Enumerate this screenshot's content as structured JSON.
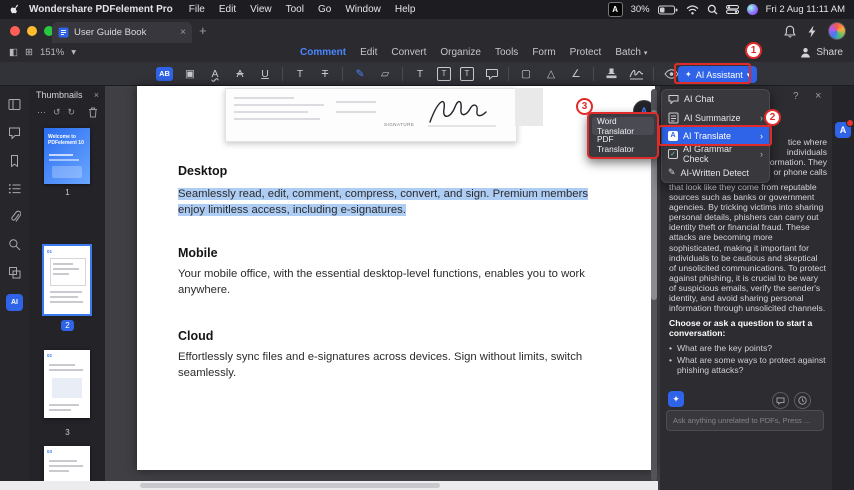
{
  "menubar": {
    "app_name": "Wondershare PDFelement Pro",
    "menus": [
      "File",
      "Edit",
      "View",
      "Tool",
      "Go",
      "Window",
      "Help"
    ],
    "capture_badge": "A",
    "battery": "30%",
    "clock": "Fri 2 Aug 11:11 AM"
  },
  "titlebar": {
    "tab_title": "User Guide Book"
  },
  "ribbon": {
    "zoom": "151%",
    "tabs": [
      "Comment",
      "Edit",
      "Convert",
      "Organize",
      "Tools",
      "Form",
      "Protect",
      "Batch"
    ],
    "share": "Share",
    "ai_assistant": "AI Assistant"
  },
  "tools": {
    "icons": [
      {
        "name": "highlight",
        "glyph": "AB"
      },
      {
        "name": "area-highlight",
        "glyph": "▣"
      },
      {
        "name": "squiggly-underline",
        "glyph": "A"
      },
      {
        "name": "strikethrough",
        "glyph": "A"
      },
      {
        "name": "underline",
        "glyph": "U"
      },
      {
        "name": "insert-text",
        "glyph": "T"
      },
      {
        "name": "replace-text",
        "glyph": "T"
      },
      {
        "name": "pencil",
        "glyph": "✎"
      },
      {
        "name": "eraser",
        "glyph": "▱"
      },
      {
        "name": "text-comment",
        "glyph": "T"
      },
      {
        "name": "text-box",
        "glyph": "T"
      },
      {
        "name": "callout",
        "glyph": "T"
      },
      {
        "name": "shape-rect",
        "glyph": "▢"
      },
      {
        "name": "shape-polygon",
        "glyph": "△"
      },
      {
        "name": "measure",
        "glyph": "∠"
      }
    ]
  },
  "sidebar": {
    "panel_title": "Thumbnails",
    "thumbs": [
      {
        "label": "1",
        "title": "Welcome to PDFelement 10"
      },
      {
        "label": "2",
        "tag": "01"
      },
      {
        "label": "3",
        "tag": "02"
      },
      {
        "tag": "03"
      }
    ]
  },
  "document": {
    "signature_label": "SIGNATURE",
    "sections": [
      {
        "heading": "Desktop",
        "body": "Seamlessly read, edit, comment, compress, convert, and sign. Premium members enjoy limitless access, including e-signatures."
      },
      {
        "heading": "Mobile",
        "body": "Your mobile office, with the essential desktop-level functions, enables you to work anywhere."
      },
      {
        "heading": "Cloud",
        "body": "Effortlessly sync files and e-signatures across devices. Sign without limits, switch seamlessly."
      }
    ]
  },
  "translator_menu": {
    "items": [
      "Word Translator",
      "PDF Translator"
    ]
  },
  "ai_menu": {
    "items": [
      {
        "label": "AI Chat",
        "chevron": ""
      },
      {
        "label": "AI Summarize",
        "chevron": "›"
      },
      {
        "label": "AI Translate",
        "chevron": "›"
      },
      {
        "label": "AI Grammar Check",
        "chevron": "›"
      },
      {
        "label": "AI-Written Detect",
        "chevron": ""
      }
    ]
  },
  "ai_panel": {
    "fragments": [
      "tice where",
      "individuals",
      "formation. They",
      "or phone calls"
    ],
    "paragraph": "that look like they come from reputable sources such as banks or government agencies. By tricking victims into sharing personal details, phishers can carry out identity theft or financial fraud. These attacks are becoming more sophisticated, making it important for individuals to be cautious and skeptical of unsolicited communications. To protect against phishing, it is crucial to be wary of suspicious emails, verify the sender's identity, and avoid sharing personal information through unsolicited channels.",
    "prompt_heading": "Choose or ask a question to start a conversation:",
    "suggestions": [
      "What are the key points?",
      "What are some ways to protect against phishing attacks?"
    ],
    "input_placeholder": "Ask anything unrelated to PDFs, Press ..."
  },
  "annotations": {
    "step1": "1",
    "step2": "2",
    "step3": "3"
  },
  "icons": {
    "more": "⋯",
    "rotate_left": "↺",
    "rotate_right": "↻",
    "close": "×",
    "help": "?",
    "chevron_down": "▾",
    "plus": "+",
    "sparkle": "✦",
    "ai_badge": "AI",
    "translate_badge": "A",
    "check": "✓",
    "pencil": "✎",
    "translate_glyph": "A"
  }
}
